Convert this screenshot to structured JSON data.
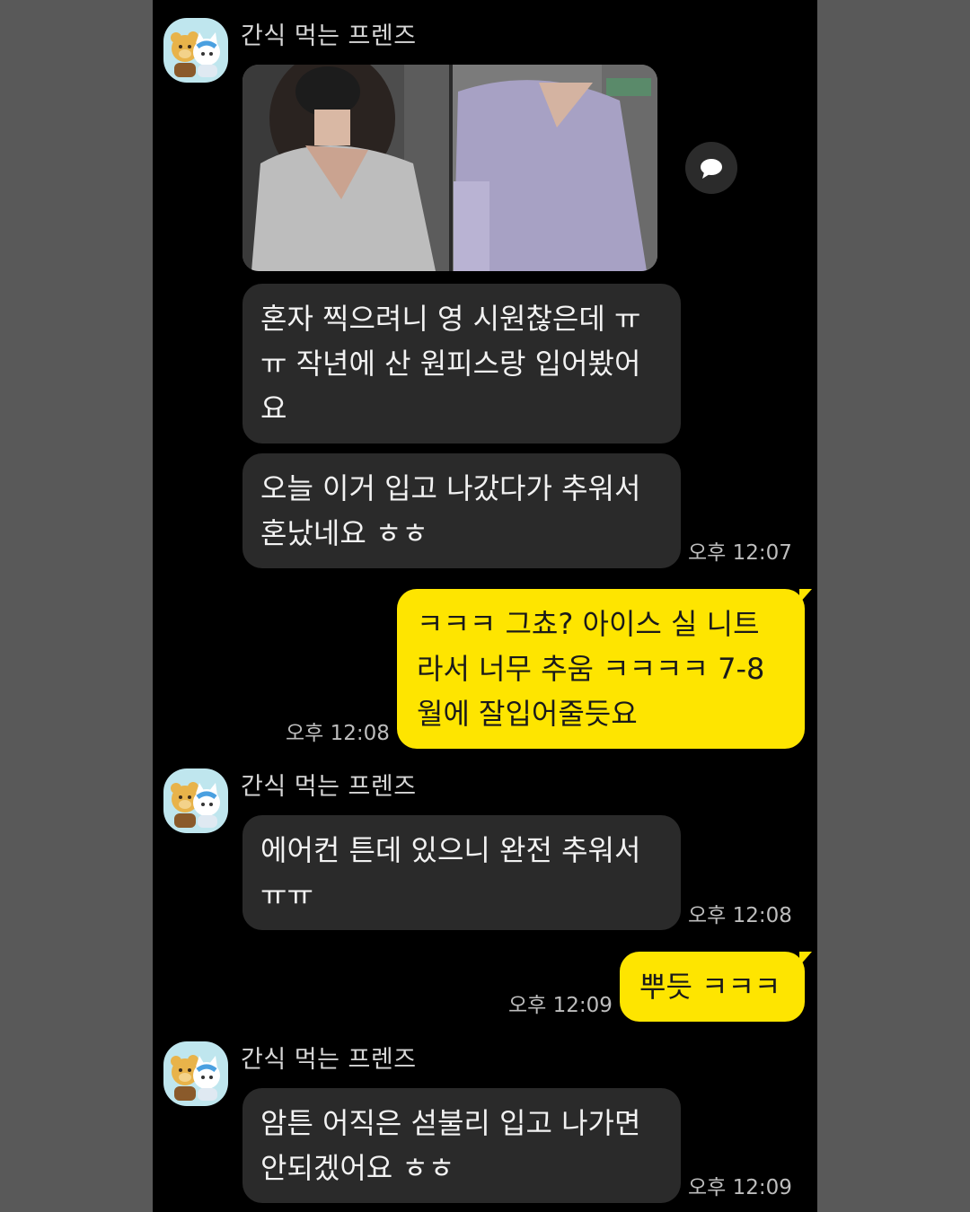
{
  "chat": {
    "sender_name": "간식 먹는 프렌즈",
    "messages": {
      "m1_text": "혼자 찍으려니 영 시원찮은데 ㅠㅠ 작년에 산 원피스랑 입어봤어요",
      "m2_text": "오늘 이거 입고 나갔다가 추워서 혼났네요 ㅎㅎ",
      "m2_time": "오후 12:07",
      "m3_text": "ㅋㅋㅋ 그쵸? 아이스 실 니트라서 너무 추움 ㅋㅋㅋㅋ 7-8월에 잘입어줄듯요",
      "m3_time": "오후 12:08",
      "m4_text": "에어컨 튼데 있으니 완전 추워서 ㅠㅠ",
      "m4_time": "오후 12:08",
      "m5_text": "뿌듯 ㅋㅋㅋ",
      "m5_time": "오후 12:09",
      "m6_text": "암튼 어직은 섣불리 입고 나가면 안되겠어요 ㅎㅎ",
      "m6_time": "오후 12:09"
    },
    "icons": {
      "avatar": "bear-and-cat-avatar-icon",
      "share": "speech-bubble-icon"
    },
    "colors": {
      "background": "#000000",
      "incoming_bubble": "#2a2a2a",
      "outgoing_bubble": "#fee500",
      "frame": "#595959"
    }
  }
}
